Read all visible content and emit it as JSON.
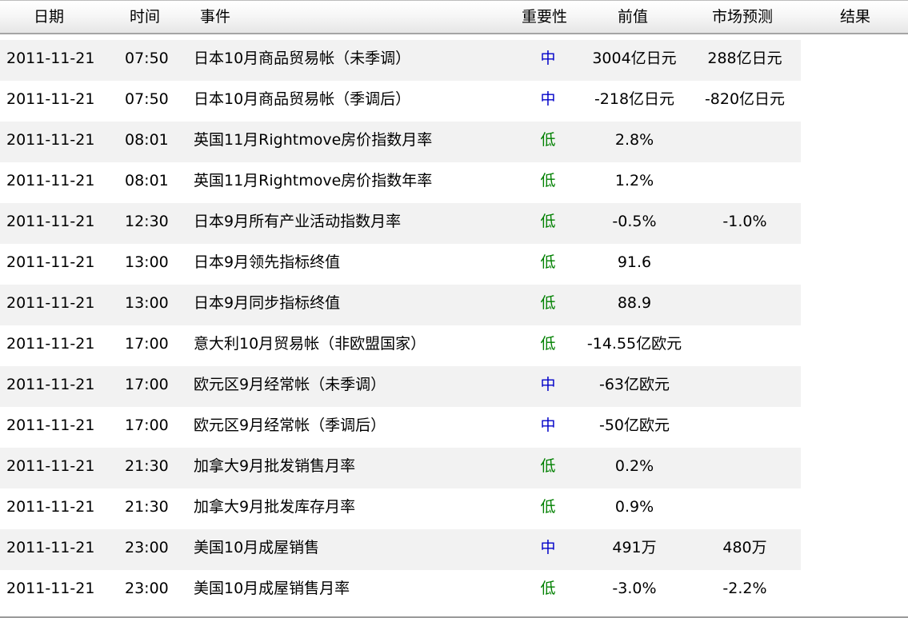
{
  "columns": {
    "date": "日期",
    "time": "时间",
    "event": "事件",
    "importance": "重要性",
    "previous": "前值",
    "forecast": "市场预测",
    "result": "结果"
  },
  "colors": {
    "importance_mid": "#0000c8",
    "importance_low": "#008000",
    "row_shade": "#f2f2f2"
  },
  "rows": [
    {
      "date": "2011-11-21",
      "time": "07:50",
      "event": "日本10月商品贸易帐（未季调）",
      "importance": "中",
      "previous": "3004亿日元",
      "forecast": "288亿日元",
      "result": ""
    },
    {
      "date": "2011-11-21",
      "time": "07:50",
      "event": "日本10月商品贸易帐（季调后）",
      "importance": "中",
      "previous": "-218亿日元",
      "forecast": "-820亿日元",
      "result": ""
    },
    {
      "date": "2011-11-21",
      "time": "08:01",
      "event": "英国11月Rightmove房价指数月率",
      "importance": "低",
      "previous": "2.8%",
      "forecast": "",
      "result": ""
    },
    {
      "date": "2011-11-21",
      "time": "08:01",
      "event": "英国11月Rightmove房价指数年率",
      "importance": "低",
      "previous": "1.2%",
      "forecast": "",
      "result": ""
    },
    {
      "date": "2011-11-21",
      "time": "12:30",
      "event": "日本9月所有产业活动指数月率",
      "importance": "低",
      "previous": "-0.5%",
      "forecast": "-1.0%",
      "result": ""
    },
    {
      "date": "2011-11-21",
      "time": "13:00",
      "event": "日本9月领先指标终值",
      "importance": "低",
      "previous": "91.6",
      "forecast": "",
      "result": ""
    },
    {
      "date": "2011-11-21",
      "time": "13:00",
      "event": "日本9月同步指标终值",
      "importance": "低",
      "previous": "88.9",
      "forecast": "",
      "result": ""
    },
    {
      "date": "2011-11-21",
      "time": "17:00",
      "event": "意大利10月贸易帐（非欧盟国家）",
      "importance": "低",
      "previous": "-14.55亿欧元",
      "forecast": "",
      "result": ""
    },
    {
      "date": "2011-11-21",
      "time": "17:00",
      "event": "欧元区9月经常帐（未季调）",
      "importance": "中",
      "previous": "-63亿欧元",
      "forecast": "",
      "result": ""
    },
    {
      "date": "2011-11-21",
      "time": "17:00",
      "event": "欧元区9月经常帐（季调后）",
      "importance": "中",
      "previous": "-50亿欧元",
      "forecast": "",
      "result": ""
    },
    {
      "date": "2011-11-21",
      "time": "21:30",
      "event": "加拿大9月批发销售月率",
      "importance": "低",
      "previous": "0.2%",
      "forecast": "",
      "result": ""
    },
    {
      "date": "2011-11-21",
      "time": "21:30",
      "event": "加拿大9月批发库存月率",
      "importance": "低",
      "previous": "0.9%",
      "forecast": "",
      "result": ""
    },
    {
      "date": "2011-11-21",
      "time": "23:00",
      "event": "美国10月成屋销售",
      "importance": "中",
      "previous": "491万",
      "forecast": "480万",
      "result": ""
    },
    {
      "date": "2011-11-21",
      "time": "23:00",
      "event": "美国10月成屋销售月率",
      "importance": "低",
      "previous": "-3.0%",
      "forecast": "-2.2%",
      "result": ""
    }
  ]
}
